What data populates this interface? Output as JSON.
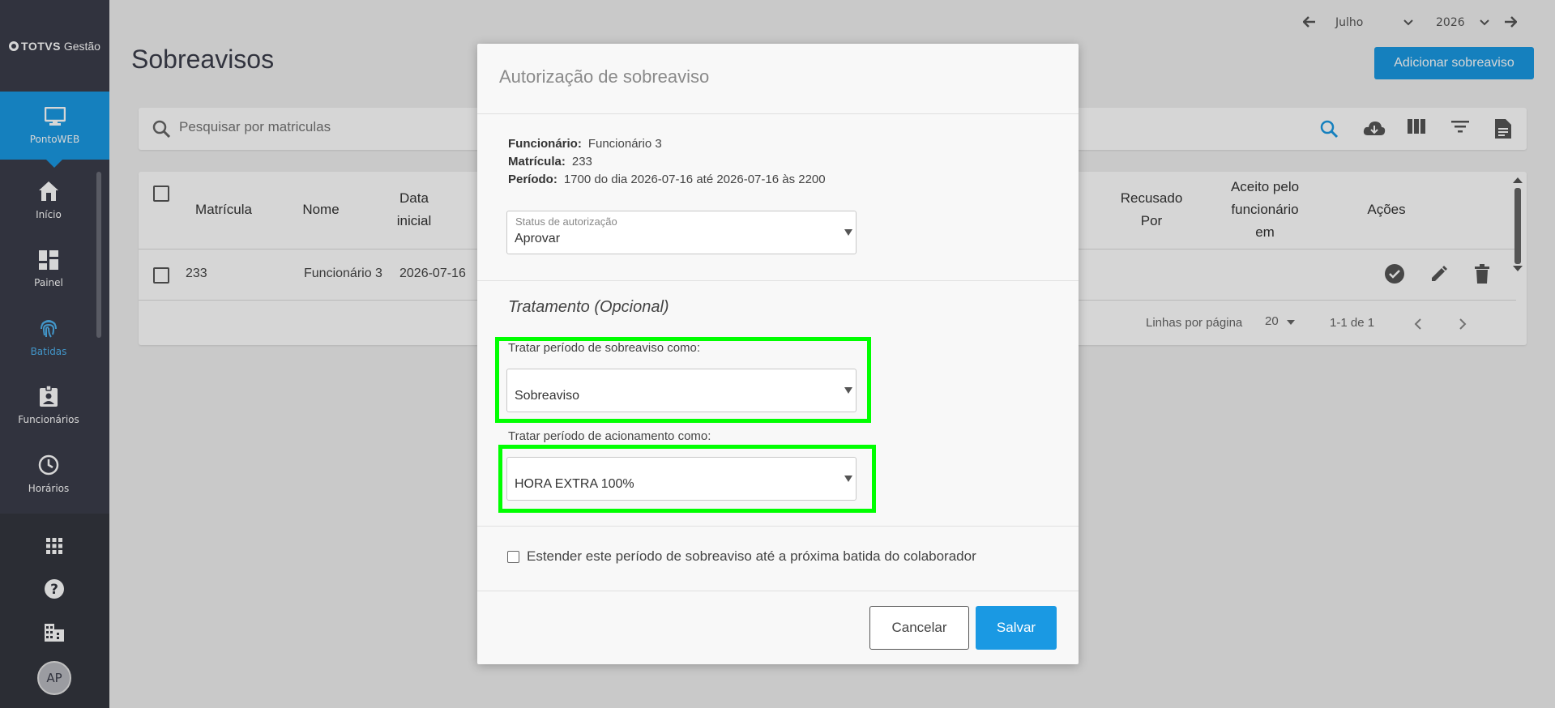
{
  "brand": {
    "name": "TOTVS",
    "suffix": "Gestão"
  },
  "sidebar": {
    "active": {
      "label": "PontoWEB",
      "icon": "monitor-icon"
    },
    "items": [
      {
        "label": "Início",
        "icon": "home-icon"
      },
      {
        "label": "Painel",
        "icon": "dashboard-icon"
      },
      {
        "label": "Batidas",
        "icon": "fingerprint-icon"
      },
      {
        "label": "Funcionários",
        "icon": "badge-icon"
      },
      {
        "label": "Horários",
        "icon": "clock-icon"
      }
    ],
    "bottom_icons": [
      "apps-grid-icon",
      "help-icon",
      "building-icon"
    ],
    "avatar_initials": "AP"
  },
  "header": {
    "title": "Sobreavisos",
    "month": "Julho",
    "year": "2026",
    "add_button": "Adicionar sobreaviso"
  },
  "search": {
    "placeholder": "Pesquisar por matriculas"
  },
  "table": {
    "columns": {
      "matricula": "Matrícula",
      "nome": "Nome",
      "data_inicial": "Data inicial",
      "recusado_por": "Recusado Por",
      "aceito": "Aceito pelo funcionário em",
      "acoes": "Ações"
    },
    "rows": [
      {
        "matricula": "233",
        "nome": "Funcionário 3",
        "data_inicial": "2026-07-16"
      }
    ],
    "footer": {
      "rows_label": "Linhas por página",
      "rows_value": "20",
      "range": "1-1 de 1"
    }
  },
  "modal": {
    "title": "Autorização de sobreaviso",
    "funcionario_label": "Funcionário:",
    "funcionario_value": "Funcionário 3",
    "matricula_label": "Matrícula:",
    "matricula_value": "233",
    "periodo_label": "Período:",
    "periodo_value": "1700 do dia 2026-07-16 até 2026-07-16 às 2200",
    "status_label": "Status de autorização",
    "status_value": "Aprovar",
    "section_title": "Tratamento (Opcional)",
    "sobreaviso_label": "Tratar período de sobreaviso como:",
    "sobreaviso_value": "Sobreaviso",
    "acionamento_label": "Tratar período de acionamento como:",
    "acionamento_value": "HORA EXTRA 100%",
    "extend_label": "Estender este período de sobreaviso até a próxima batida do colaborador",
    "cancel": "Cancelar",
    "save": "Salvar"
  },
  "colors": {
    "primary": "#1a99e3",
    "highlight": "#00ff00",
    "sidebar": "#3b3d4a"
  }
}
